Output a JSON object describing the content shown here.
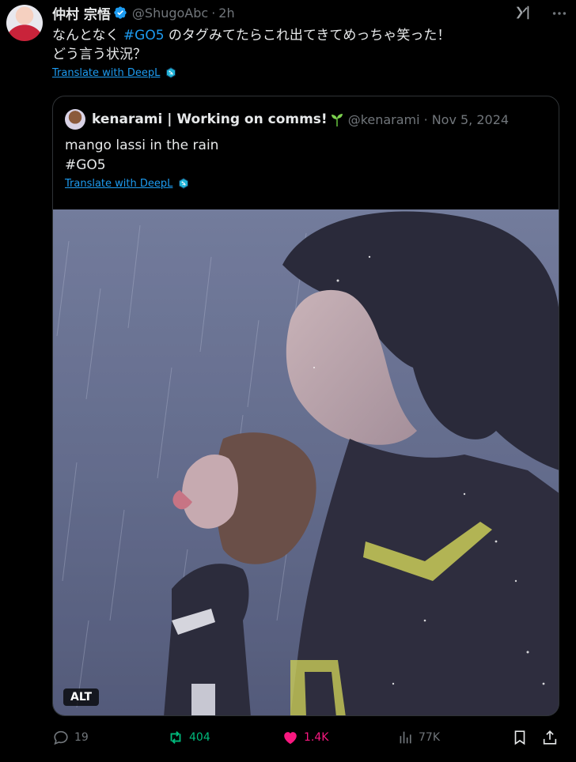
{
  "author": {
    "display_name": "仲村 宗悟",
    "handle": "@ShugoAbc",
    "separator": "·",
    "time": "2h"
  },
  "tweet": {
    "text_before": "なんとなく ",
    "hashtag": "#GO5",
    "text_after": " のタグみてたらこれ出てきてめっちゃ笑った！",
    "line2": "どう言う状況？",
    "translate_label": "Translate with DeepL"
  },
  "quote": {
    "display_name": "kenarami | Working on comms!",
    "handle": "@kenarami",
    "separator": "·",
    "date": "Nov 5, 2024",
    "line1": "mango lassi in the rain",
    "line2": "#GO5",
    "translate_label": "Translate with DeepL",
    "alt_label": "ALT"
  },
  "actions": {
    "replies": "19",
    "retweets": "404",
    "likes": "1.4K",
    "views": "77K"
  },
  "colors": {
    "background": "#000000",
    "text": "#e7e9ea",
    "muted": "#71767b",
    "link": "#1d9bf0",
    "retweet_active": "#00ba7c",
    "like_active": "#f91880",
    "border": "#2f3336"
  },
  "icons": [
    "verified-badge-icon",
    "xai-grok-icon",
    "more-icon",
    "deepl-icon",
    "sprout-icon",
    "reply-icon",
    "retweet-icon",
    "heart-icon",
    "views-icon",
    "bookmark-icon",
    "share-icon"
  ]
}
